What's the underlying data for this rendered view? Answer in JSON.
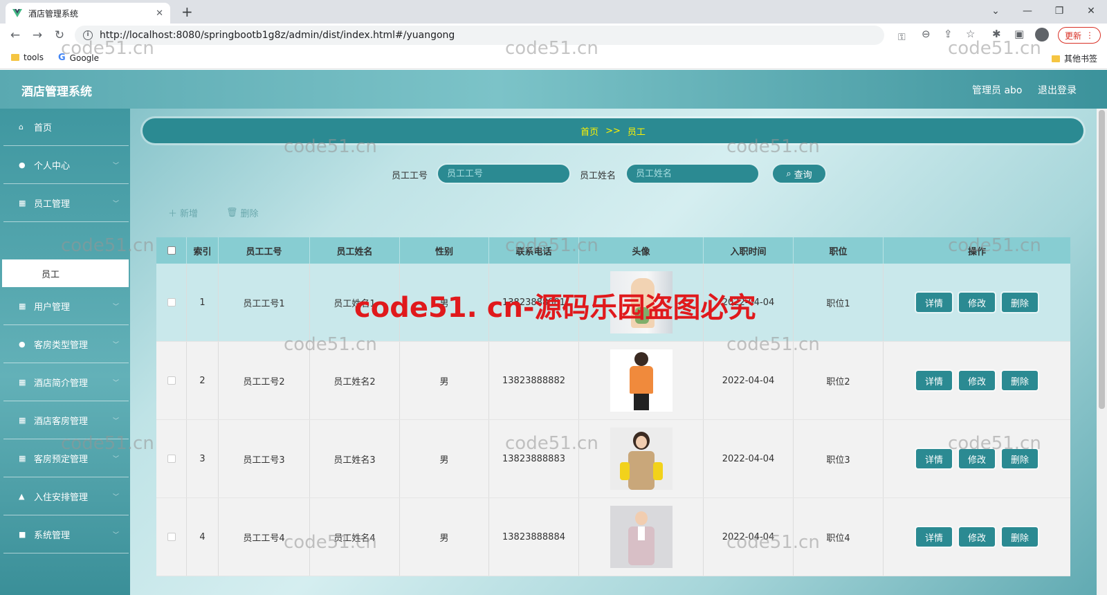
{
  "browser": {
    "tab_title": "酒店管理系统",
    "url": "http://localhost:8080/springbootb1g8z/admin/dist/index.html#/yuangong",
    "update_label": "更新",
    "bookmarks": [
      "tools",
      "Google"
    ],
    "other_bookmarks": "其他书签"
  },
  "app": {
    "title": "酒店管理系统",
    "user_label": "管理员 abo",
    "logout_label": "退出登录"
  },
  "sidebar": {
    "items": [
      {
        "label": "首页",
        "icon": "home-icon"
      },
      {
        "label": "个人中心",
        "icon": "user-icon"
      },
      {
        "label": "员工管理",
        "icon": "grid-icon"
      },
      {
        "label": "用户管理",
        "icon": "grid-icon"
      },
      {
        "label": "客房类型管理",
        "icon": "user-icon"
      },
      {
        "label": "酒店简介管理",
        "icon": "grid-icon"
      },
      {
        "label": "酒店客房管理",
        "icon": "grid-icon"
      },
      {
        "label": "客房预定管理",
        "icon": "grid-icon"
      },
      {
        "label": "入住安排管理",
        "icon": "thumb-icon"
      },
      {
        "label": "系统管理",
        "icon": "lock-icon"
      }
    ],
    "active_sub": "员工"
  },
  "breadcrumb": {
    "home": "首页",
    "sep": ">>",
    "current": "员工"
  },
  "search": {
    "field1_label": "员工工号",
    "field1_placeholder": "员工工号",
    "field2_label": "员工姓名",
    "field2_placeholder": "员工姓名",
    "query_label": "查询"
  },
  "actions": {
    "add_label": "新增",
    "delete_label": "删除"
  },
  "table": {
    "headers": [
      "索引",
      "员工工号",
      "员工姓名",
      "性别",
      "联系电话",
      "头像",
      "入职时间",
      "职位",
      "操作"
    ],
    "rows": [
      {
        "index": "1",
        "emp_no": "员工工号1",
        "name": "员工姓名1",
        "gender": "男",
        "phone": "13823888881",
        "date": "2022-04-04",
        "position": "职位1"
      },
      {
        "index": "2",
        "emp_no": "员工工号2",
        "name": "员工姓名2",
        "gender": "男",
        "phone": "13823888882",
        "date": "2022-04-04",
        "position": "职位2"
      },
      {
        "index": "3",
        "emp_no": "员工工号3",
        "name": "员工姓名3",
        "gender": "男",
        "phone": "13823888883",
        "date": "2022-04-04",
        "position": "职位3"
      },
      {
        "index": "4",
        "emp_no": "员工工号4",
        "name": "员工姓名4",
        "gender": "男",
        "phone": "13823888884",
        "date": "2022-04-04",
        "position": "职位4"
      }
    ],
    "op_labels": {
      "detail": "详情",
      "edit": "修改",
      "delete": "删除"
    }
  },
  "watermark": {
    "small": "code51.cn",
    "big": "code51. cn-源码乐园盗图必究"
  }
}
